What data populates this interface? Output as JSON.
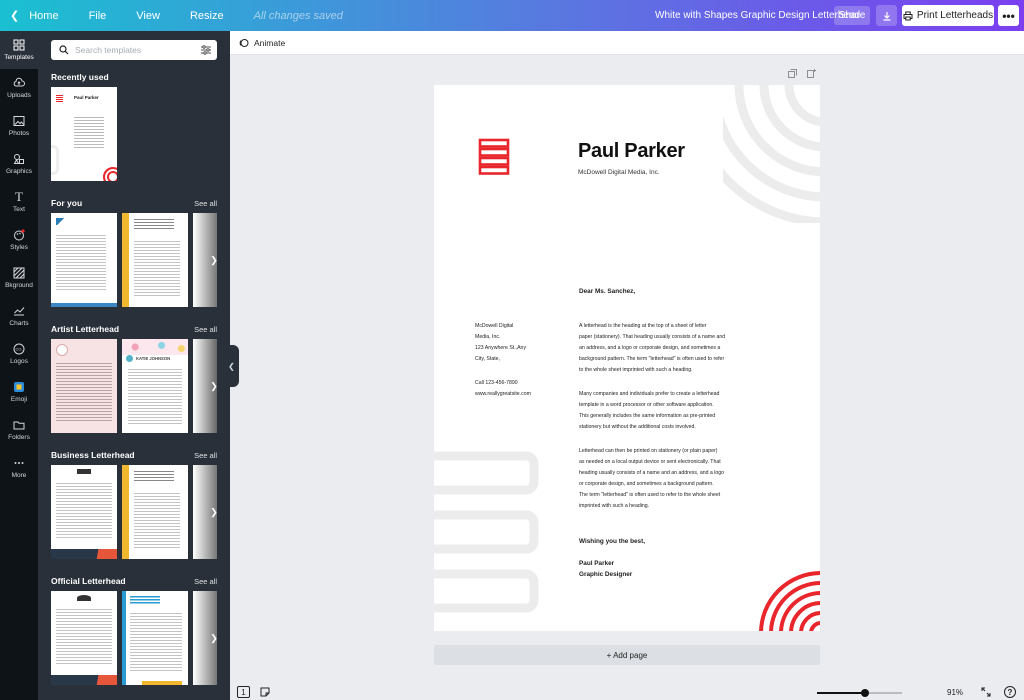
{
  "topbar": {
    "home_label": "Home",
    "menu": [
      "File",
      "View",
      "Resize"
    ],
    "saved_status": "All changes saved",
    "doc_title": "White with Shapes Graphic Design Letterhead",
    "share_label": "Share",
    "print_label": "Print Letterheads",
    "more_label": "•••"
  },
  "rail": [
    {
      "label": "Templates",
      "icon": "templates-icon"
    },
    {
      "label": "Uploads",
      "icon": "upload-icon"
    },
    {
      "label": "Photos",
      "icon": "photos-icon"
    },
    {
      "label": "Graphics",
      "icon": "graphics-icon"
    },
    {
      "label": "Text",
      "icon": "text-icon"
    },
    {
      "label": "Styles",
      "icon": "styles-icon"
    },
    {
      "label": "Bkground",
      "icon": "background-icon"
    },
    {
      "label": "Charts",
      "icon": "charts-icon"
    },
    {
      "label": "Logos",
      "icon": "logos-icon"
    },
    {
      "label": "Emoji",
      "icon": "emoji-icon"
    },
    {
      "label": "Folders",
      "icon": "folder-icon"
    },
    {
      "label": "More",
      "icon": "more-icon"
    }
  ],
  "panel": {
    "search_placeholder": "Search templates",
    "sections": [
      {
        "title": "Recently used",
        "see_all": ""
      },
      {
        "title": "For you",
        "see_all": "See all"
      },
      {
        "title": "Artist Letterhead",
        "see_all": "See all"
      },
      {
        "title": "Business Letterhead",
        "see_all": "See all"
      },
      {
        "title": "Official Letterhead",
        "see_all": "See all"
      }
    ],
    "thumb_labels": {
      "recent": "Paul Parker",
      "artist_2": "KATIE JOHNSON"
    }
  },
  "editor": {
    "animate_label": "Animate",
    "add_page_label": "+ Add page",
    "zoom": "91%",
    "page_number": "1"
  },
  "letter": {
    "name": "Paul Parker",
    "company": "McDowell Digital Media, Inc.",
    "salutation": "Dear Ms. Sanchez,",
    "address_lines": [
      "McDowell Digital",
      "Media, Inc.",
      "123 Anywhere St.,Any",
      "City, State,"
    ],
    "phone": "Call 123-456-7890",
    "website": "www.reallygreatsite.com",
    "paragraphs": [
      [
        "A letterhead is the heading at the top of a sheet of letter",
        "paper (stationery). That heading usually consists of a name and",
        "an address, and a logo or corporate design, and sometimes a",
        "background pattern. The term \"letterhead\" is often used to refer",
        "to the whole sheet imprinted with such a heading."
      ],
      [
        "Many companies and individuals prefer to create a letterhead",
        "template in a word processor or other software application.",
        "This generally includes the same information as pre-printed",
        "stationery but without the additional costs involved."
      ],
      [
        "Letterhead can then be printed on stationery (or plain paper)",
        "as needed on a local output device or sent electronically. That",
        "heading usually consists of a name and an address, and a logo",
        "or corporate design, and sometimes a background pattern.",
        "The term \"letterhead\" is often used to refer to the whole sheet",
        "imprinted with such a heading."
      ]
    ],
    "closing": "Wishing you the best,",
    "signature_name": "Paul Parker",
    "signature_title": "Graphic Designer"
  },
  "colors": {
    "accent_red": "#e8262c",
    "panel_bg": "#293039",
    "rail_bg": "#0e1318",
    "gradient_start": "#1ac0d1",
    "gradient_end": "#7b3ff0"
  }
}
